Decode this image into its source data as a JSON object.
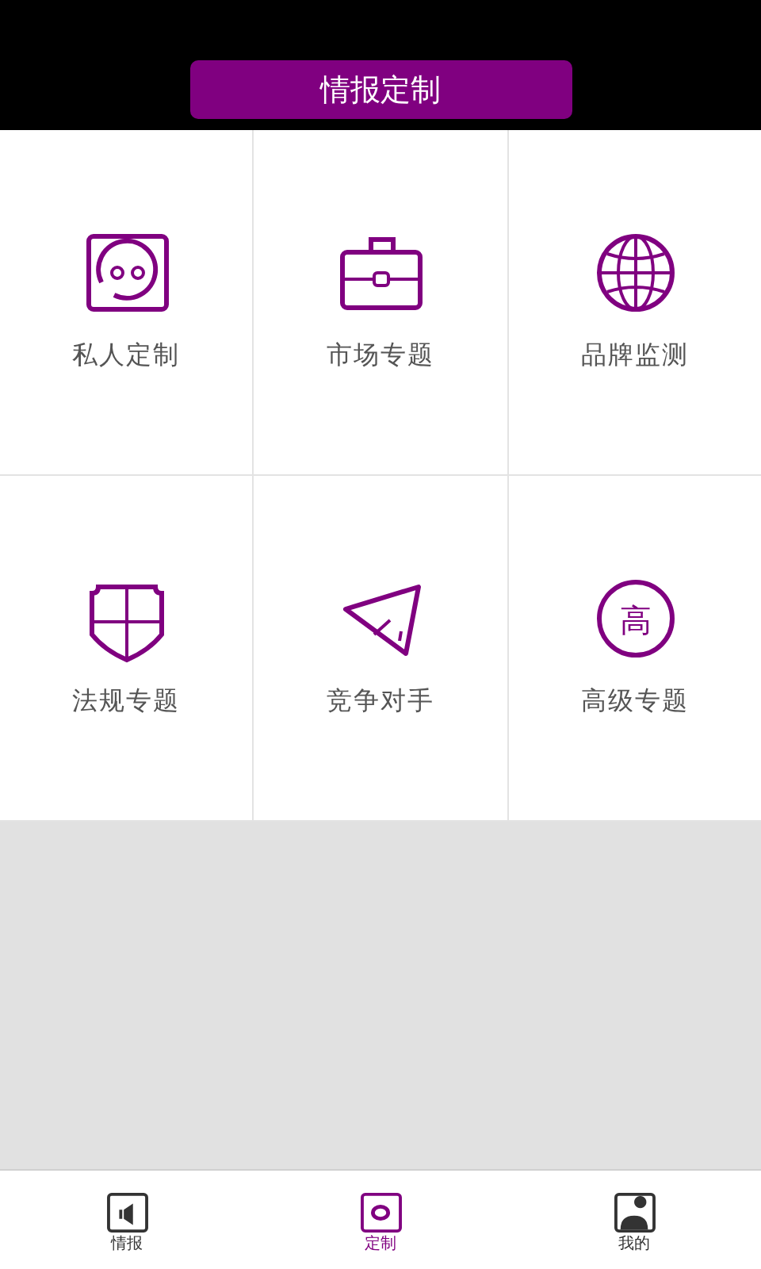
{
  "header": {
    "title": "情报定制"
  },
  "tiles": [
    {
      "kind": "face",
      "label": "私人定制"
    },
    {
      "kind": "briefcase",
      "label": "市场专题"
    },
    {
      "kind": "globe",
      "label": "品牌监测"
    },
    {
      "kind": "shield",
      "label": "法规专题"
    },
    {
      "kind": "plane",
      "label": "竞争对手"
    },
    {
      "kind": "seal",
      "label": "高级专题",
      "icon_text": "高"
    }
  ],
  "tab_bar": [
    {
      "kind": "speaker",
      "label": "情报",
      "selected": false
    },
    {
      "kind": "ring",
      "label": "定制",
      "selected": true
    },
    {
      "kind": "person",
      "label": "我的",
      "selected": false
    }
  ]
}
